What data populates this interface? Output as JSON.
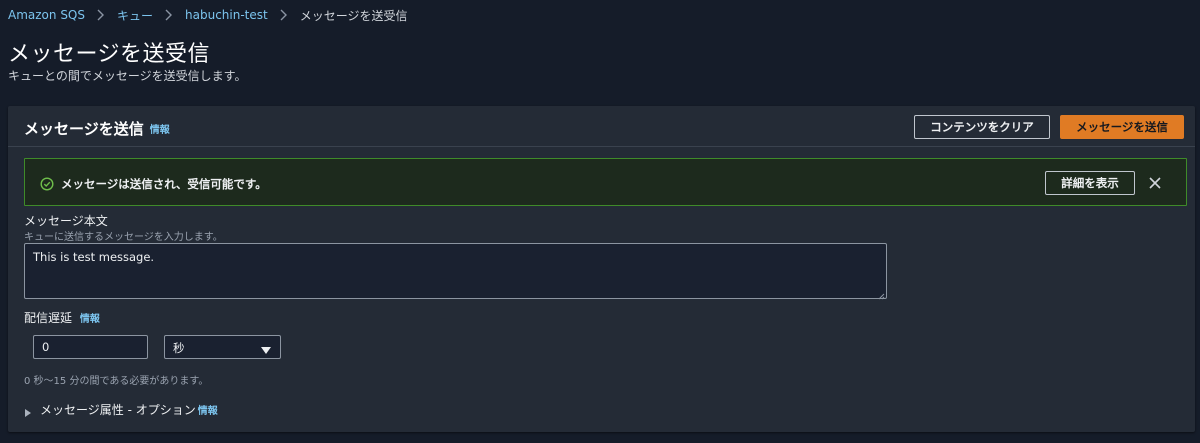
{
  "breadcrumb": {
    "items": [
      "Amazon SQS",
      "キュー",
      "habuchin-test"
    ],
    "current": "メッセージを送受信"
  },
  "page": {
    "title": "メッセージを送受信",
    "subtitle": "キューとの間でメッセージを送受信します。"
  },
  "panel": {
    "title": "メッセージを送信",
    "info_label": "情報",
    "clear_button": "コンテンツをクリア",
    "send_button": "メッセージを送信"
  },
  "alert": {
    "text": "メッセージは送信され、受信可能です。",
    "details_button": "詳細を表示",
    "status_color": "#3f8b29"
  },
  "body_field": {
    "label": "メッセージ本文",
    "description": "キューに送信するメッセージを入力します。",
    "value": "This is test message."
  },
  "delay_field": {
    "label": "配信遅延",
    "info_label": "情報",
    "value": "0",
    "unit": "秒",
    "hint": "0 秒〜15 分の間である必要があります。"
  },
  "attributes": {
    "label": "メッセージ属性 - オプション",
    "info_label": "情報"
  },
  "colors": {
    "accent": "#e07b24",
    "link": "#7cc4ee",
    "background": "#151c29",
    "panel": "#242b36"
  },
  "icons": {
    "breadcrumb_separator": "chevron-right-icon",
    "success": "check-circle-icon",
    "close": "close-icon",
    "dropdown": "caret-down-icon",
    "expand": "caret-right-icon"
  }
}
